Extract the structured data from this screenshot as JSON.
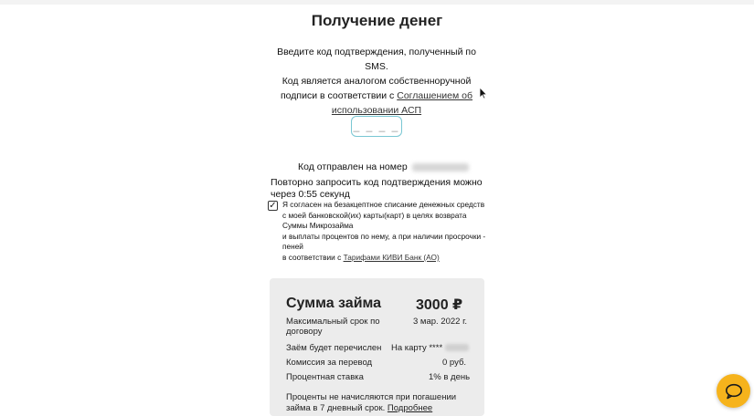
{
  "page": {
    "title": "Получение денег"
  },
  "intro": {
    "line1": "Введите код подтверждения, полученный по SMS.",
    "line2": "Код является аналогом собственноручной",
    "line3": "подписи в соответствии с",
    "link": "Соглашением об использовании АСП"
  },
  "code_input": {
    "placeholder": "_ _ _ _"
  },
  "sent": {
    "label": "Код отправлен на номер"
  },
  "resend": {
    "text": "Повторно запросить код подтверждения можно через 0:55 секунд"
  },
  "consent": {
    "checked": true,
    "check_mark": "✓",
    "line1": "Я согласен на безакцептное списание денежных средств",
    "line2": "с моей банковской(их) карты(карт) в целях возврата",
    "line3": "Суммы Микрозайма",
    "line4": "и выплаты процентов по нему, а при наличии просрочки -",
    "line5": "пеней",
    "line6_prefix": "в соответствии с",
    "link": "Тарифами КИВИ Банк (АО)"
  },
  "loan": {
    "sum_label": "Сумма займа",
    "sum_value": "3000 ₽",
    "rows": [
      {
        "label": "Максимальный срок по договору",
        "value": "3 мар. 2022 г."
      },
      {
        "label": "Заём будет перечислен",
        "value": "На карту ****"
      },
      {
        "label": "Комиссия за перевод",
        "value": "0 руб."
      },
      {
        "label": "Процентная ставка",
        "value": "1% в день"
      }
    ],
    "footnote": "Проценты не начисляются при погашении займа в 7 дневный срок.",
    "footnote_link": "Подробнее"
  },
  "chat": {
    "icon": "chat-bubble-icon",
    "color": "#f6b31c"
  },
  "colors": {
    "input_border": "#79c7d3",
    "summary_bg": "#ececec"
  }
}
